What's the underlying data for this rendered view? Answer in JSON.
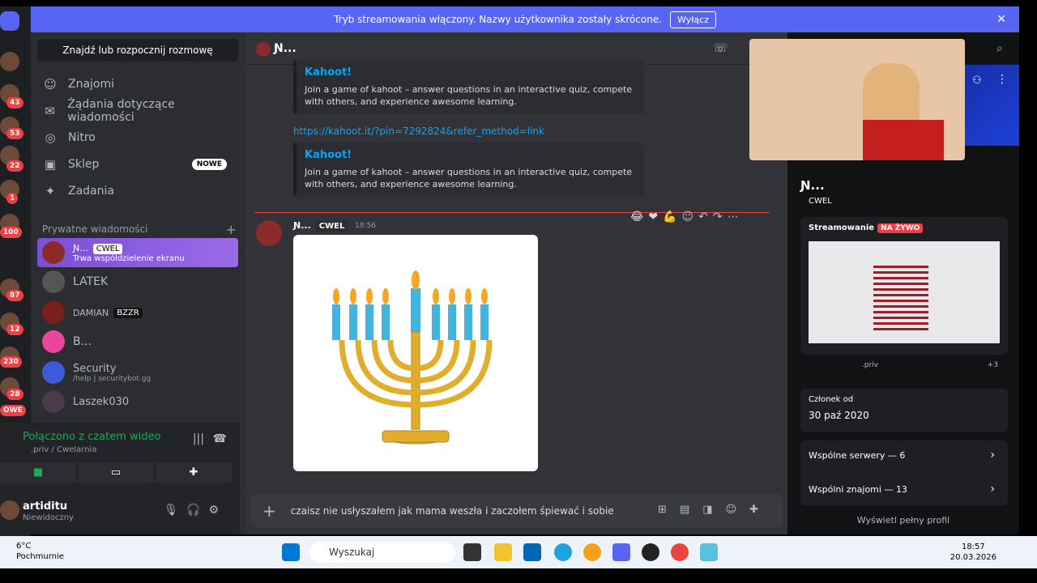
{
  "banner": {
    "text": "Tryb streamowania włączony. Nazwy użytkownika zostały skrócone.",
    "button": "Wyłącz"
  },
  "guild_badges": [
    "43",
    "53",
    "22",
    "1",
    "100",
    "87",
    "12",
    "230",
    "28",
    "OWE"
  ],
  "sidebar": {
    "search": "Znajdź lub rozpocznij rozmowę",
    "nav": [
      {
        "label": "Znajomi"
      },
      {
        "label": "Żądania dotyczące wiadomości"
      },
      {
        "label": "Nitro"
      },
      {
        "label": "Sklep",
        "badge": "NOWE"
      },
      {
        "label": "Zadania"
      }
    ],
    "pm_header": "Prywatne wiadomości",
    "dms": [
      {
        "name": "Ɲ...",
        "tag": "CWEL",
        "sub": "Trwa współdzielenie ekranu"
      },
      {
        "name": "LATEK"
      },
      {
        "name": "DAMIAN",
        "tag": "BZZR"
      },
      {
        "name": "B..."
      },
      {
        "name": "Security",
        "sub": "/help | securitybot.gg"
      },
      {
        "name": "Laszek030"
      }
    ]
  },
  "voice": {
    "title": "Połączono z czatem wideo",
    "sub": ".priv / Cwelarnia"
  },
  "user": {
    "name": "artiditu",
    "status": "Niewidoczny"
  },
  "chat": {
    "header_name": "Ɲ...",
    "embeds": [
      {
        "title": "Kahoot!",
        "desc": "Join a game of kahoot – answer questions in an interactive quiz, compete with others, and experience awesome learning."
      },
      {
        "title": "Kahoot!",
        "desc": "Join a game of kahoot – answer questions in an interactive quiz, compete with others, and experience awesome learning."
      }
    ],
    "link": "https://kahoot.it/?pin=7292824&refer_method=link",
    "message": {
      "author": "Ɲ...",
      "tag": "CWEL",
      "time": "18:56"
    },
    "composer_text": "czaisz nie usłyszałem jak mama weszła i zaczołem śpiewać i sobie"
  },
  "profile": {
    "name": "Ɲ...",
    "tag": "CWEL",
    "stream_label": "Streamowanie",
    "live": "NA ŻYWO",
    "stream_channel": ".priv",
    "viewers_extra": "+3",
    "member_since_label": "Członek od",
    "member_since": "30 paź 2020",
    "shared_servers": "Wspólne serwery — 6",
    "shared_friends": "Wspólni znajomi — 13",
    "full_profile": "Wyświetl pełny profil"
  },
  "taskbar": {
    "weather_temp": "6°C",
    "weather_desc": "Pochmurnie",
    "search": "Wyszukaj",
    "time": "18:57",
    "date": "20.03.2026"
  }
}
